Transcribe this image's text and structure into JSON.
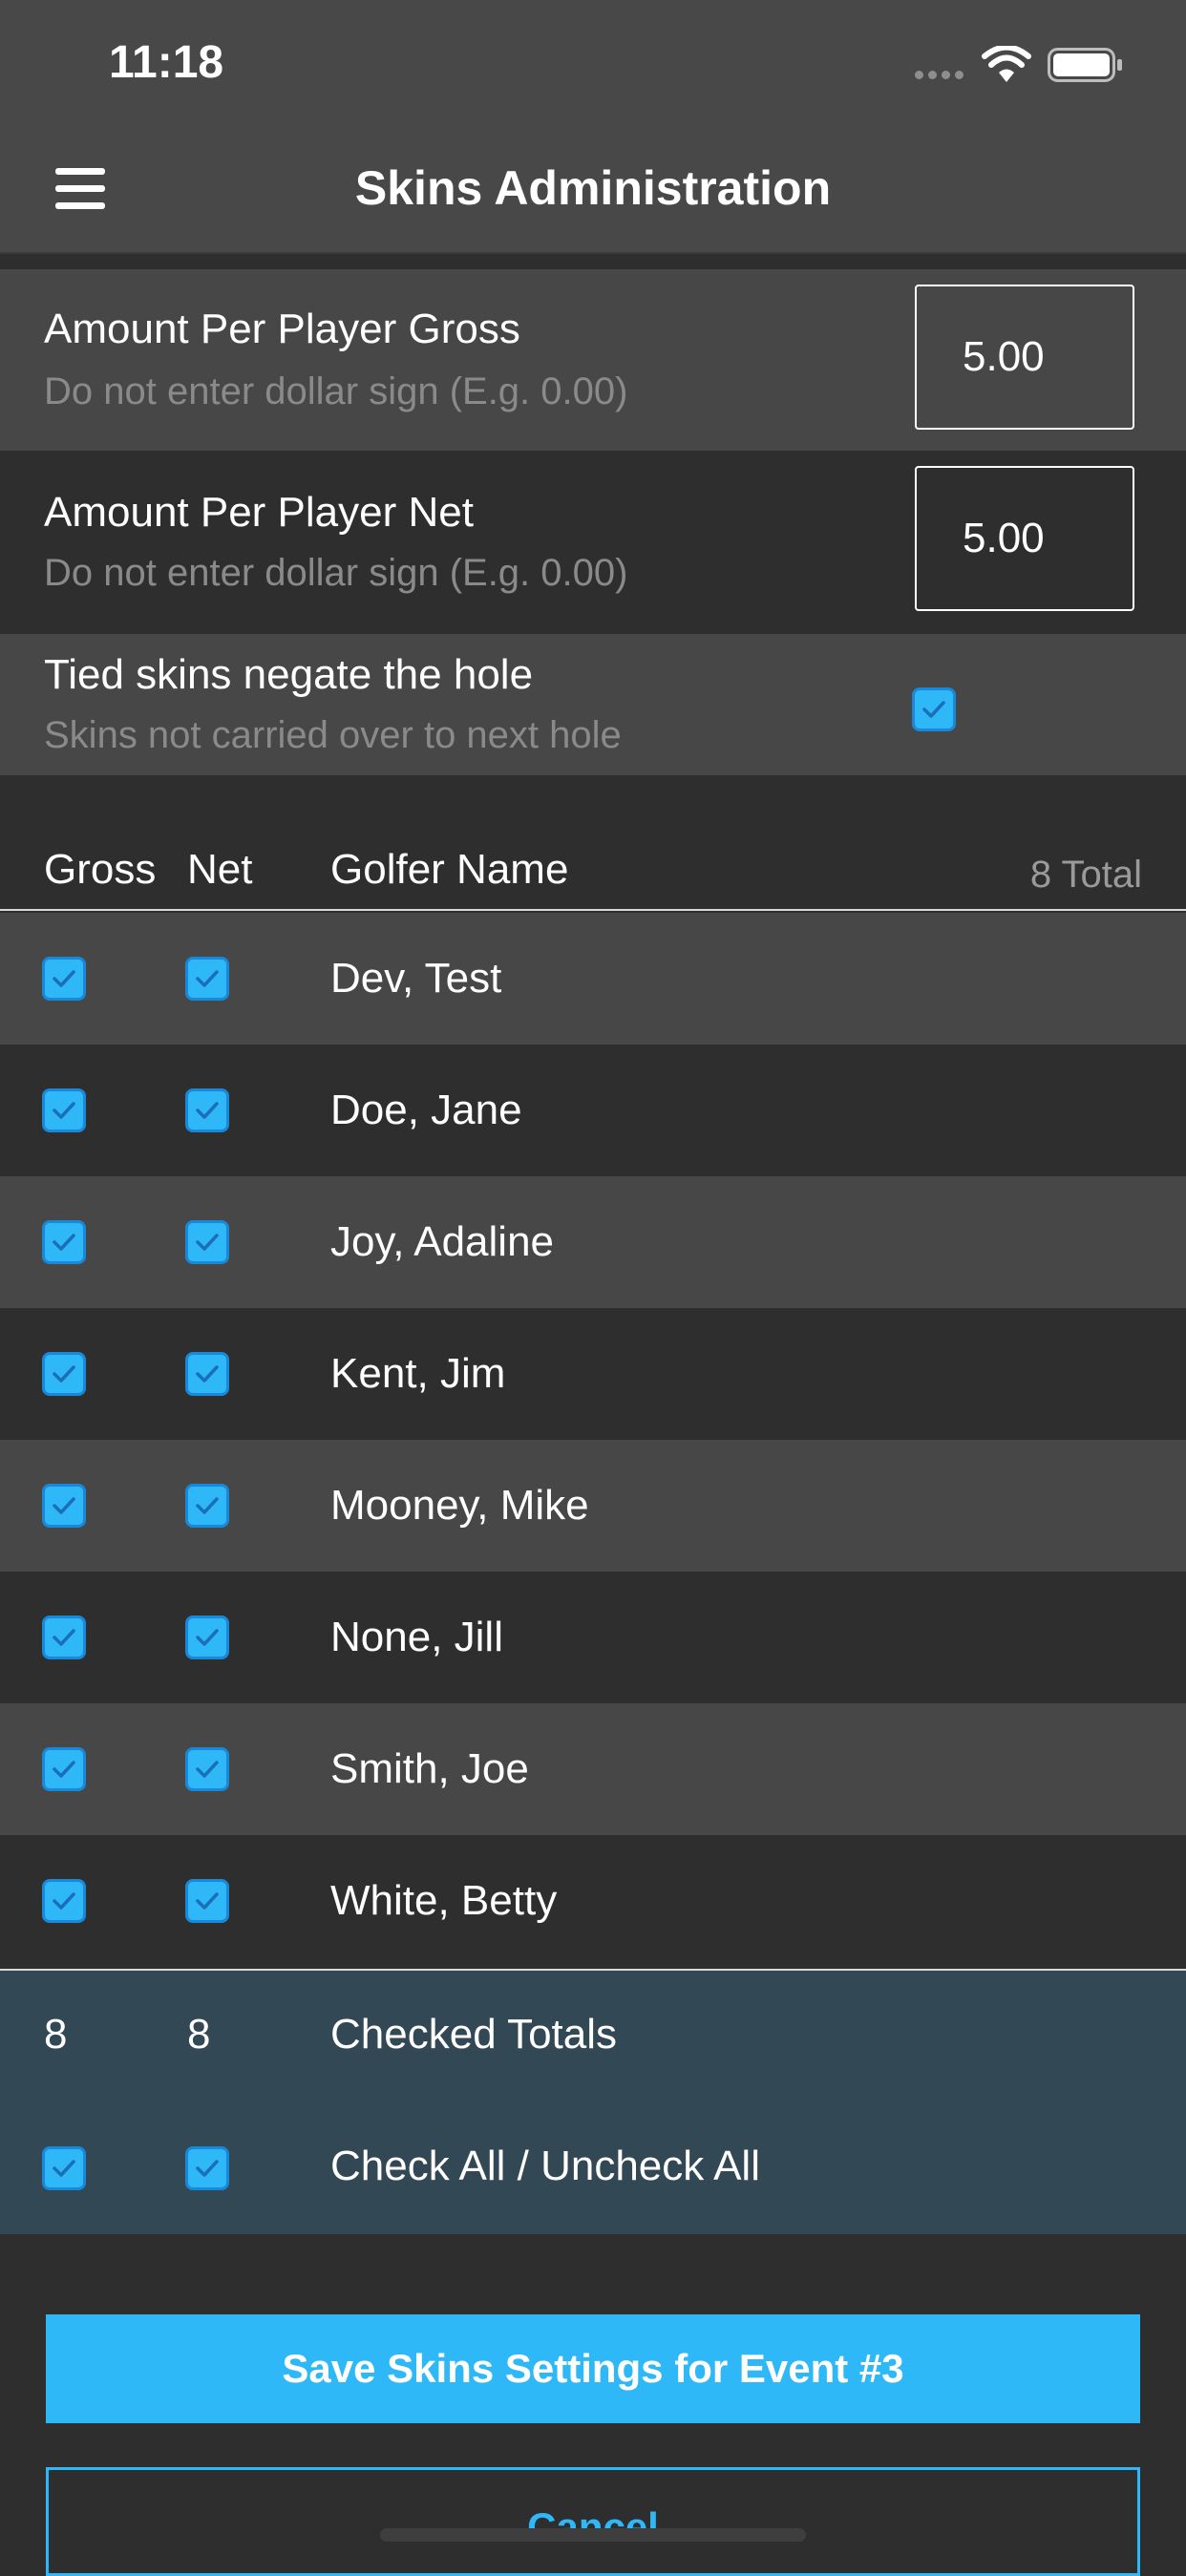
{
  "status_bar": {
    "time": "11:18"
  },
  "nav": {
    "title": "Skins Administration"
  },
  "settings": {
    "gross": {
      "title": "Amount Per Player Gross",
      "hint": "Do not enter dollar sign (E.g. 0.00)",
      "value": "5.00"
    },
    "net": {
      "title": "Amount Per Player Net",
      "hint": "Do not enter dollar sign (E.g. 0.00)",
      "value": "5.00"
    },
    "tied": {
      "title": "Tied skins negate the hole",
      "hint": "Skins not carried over to next hole",
      "checked": true
    }
  },
  "table": {
    "headers": {
      "gross": "Gross",
      "net": "Net",
      "name": "Golfer Name",
      "total": "8 Total"
    },
    "rows": [
      {
        "name": "Dev, Test",
        "gross": true,
        "net": true
      },
      {
        "name": "Doe, Jane",
        "gross": true,
        "net": true
      },
      {
        "name": "Joy, Adaline",
        "gross": true,
        "net": true
      },
      {
        "name": "Kent, Jim",
        "gross": true,
        "net": true
      },
      {
        "name": "Mooney, Mike",
        "gross": true,
        "net": true
      },
      {
        "name": "None, Jill",
        "gross": true,
        "net": true
      },
      {
        "name": "Smith, Joe",
        "gross": true,
        "net": true
      },
      {
        "name": "White, Betty",
        "gross": true,
        "net": true
      }
    ]
  },
  "totals": {
    "gross_count": "8",
    "net_count": "8",
    "checked_label": "Checked Totals",
    "check_all_label": "Check All / Uncheck All"
  },
  "actions": {
    "save_label": "Save Skins Settings for Event #3",
    "cancel_label": "Cancel"
  },
  "colors": {
    "accent": "#2fb8f7",
    "row_light": "#474747",
    "row_dark": "#2e2e2e",
    "totals_bg": "#324855"
  }
}
